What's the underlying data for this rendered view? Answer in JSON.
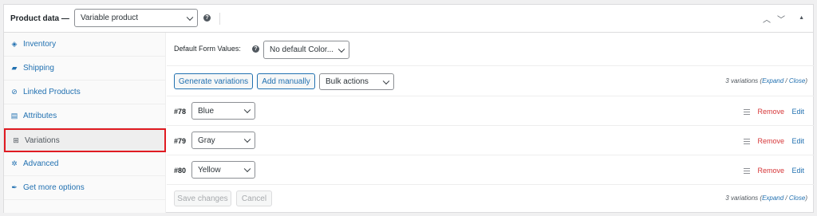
{
  "header": {
    "title": "Product data —",
    "product_type": "Variable product",
    "help": "?",
    "collapse_up": "︿",
    "collapse_down": "﹀",
    "toggle": "▲"
  },
  "sidebar": {
    "items": [
      {
        "label": "Inventory",
        "icon": "tag-icon",
        "glyph": "◈"
      },
      {
        "label": "Shipping",
        "icon": "truck-icon",
        "glyph": "▰"
      },
      {
        "label": "Linked Products",
        "icon": "link-icon",
        "glyph": "⊘"
      },
      {
        "label": "Attributes",
        "icon": "table-icon",
        "glyph": "▤"
      },
      {
        "label": "Variations",
        "icon": "grid-icon",
        "glyph": "⊞"
      },
      {
        "label": "Advanced",
        "icon": "gear-icon",
        "glyph": "✲"
      },
      {
        "label": "Get more options",
        "icon": "plugin-icon",
        "glyph": "✒"
      }
    ],
    "active_index": 4,
    "highlight_color": "#e01b22"
  },
  "defaults": {
    "label": "Default Form Values:",
    "help": "?",
    "select_value": "No default Color..."
  },
  "toolbar": {
    "generate": "Generate variations",
    "add_manually": "Add manually",
    "bulk_actions": "Bulk actions",
    "count_prefix": "3 variations (",
    "expand": "Expand",
    "slash": " / ",
    "close": "Close",
    "count_suffix": ")"
  },
  "variations": [
    {
      "id": "#78",
      "value": "Blue",
      "remove": "Remove",
      "edit": "Edit"
    },
    {
      "id": "#79",
      "value": "Gray",
      "remove": "Remove",
      "edit": "Edit"
    },
    {
      "id": "#80",
      "value": "Yellow",
      "remove": "Remove",
      "edit": "Edit"
    }
  ],
  "footer": {
    "save": "Save changes",
    "cancel": "Cancel",
    "count_prefix": "3 variations (",
    "expand": "Expand",
    "slash": " / ",
    "close": "Close",
    "count_suffix": ")"
  },
  "colors": {
    "link": "#2271b1",
    "remove": "#d63638",
    "border": "#dcdcde"
  }
}
